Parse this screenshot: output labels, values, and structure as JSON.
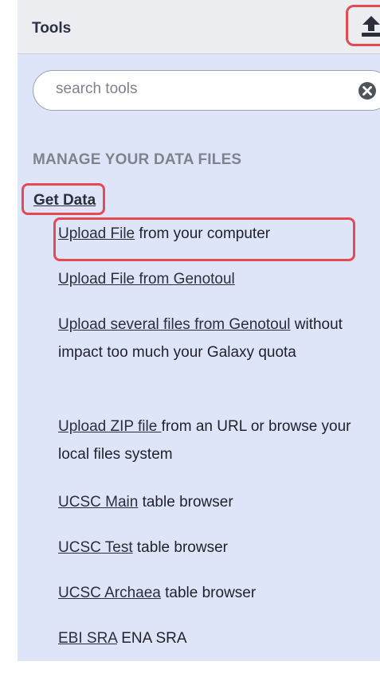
{
  "header": {
    "title": "Tools",
    "upload_icon": "upload-icon"
  },
  "search": {
    "placeholder": "search tools",
    "value": "",
    "clear_icon": "clear-circle-icon"
  },
  "section": {
    "title": "MANAGE YOUR DATA FILES"
  },
  "category": {
    "label": "Get Data"
  },
  "tools": [
    {
      "link": "Upload File",
      "desc": " from your computer"
    },
    {
      "link": "Upload File from Genotoul",
      "desc": ""
    },
    {
      "link": "Upload several files from Genotoul",
      "desc": " without impact too much your Galaxy quota"
    },
    {
      "link": "Upload ZIP file ",
      "desc": "from an URL or browse your local files system"
    },
    {
      "link": "UCSC Main",
      "desc": " table browser"
    },
    {
      "link": "UCSC Test",
      "desc": " table browser"
    },
    {
      "link": "UCSC Archaea",
      "desc": " table browser"
    },
    {
      "link": "EBI SRA",
      "desc": " ENA SRA"
    }
  ],
  "colors": {
    "panel_bg": "#dfe5f9",
    "header_bg": "#ebedf0",
    "highlight": "#e34a52",
    "link": "#2b2f39",
    "section_title": "#7f848c"
  }
}
